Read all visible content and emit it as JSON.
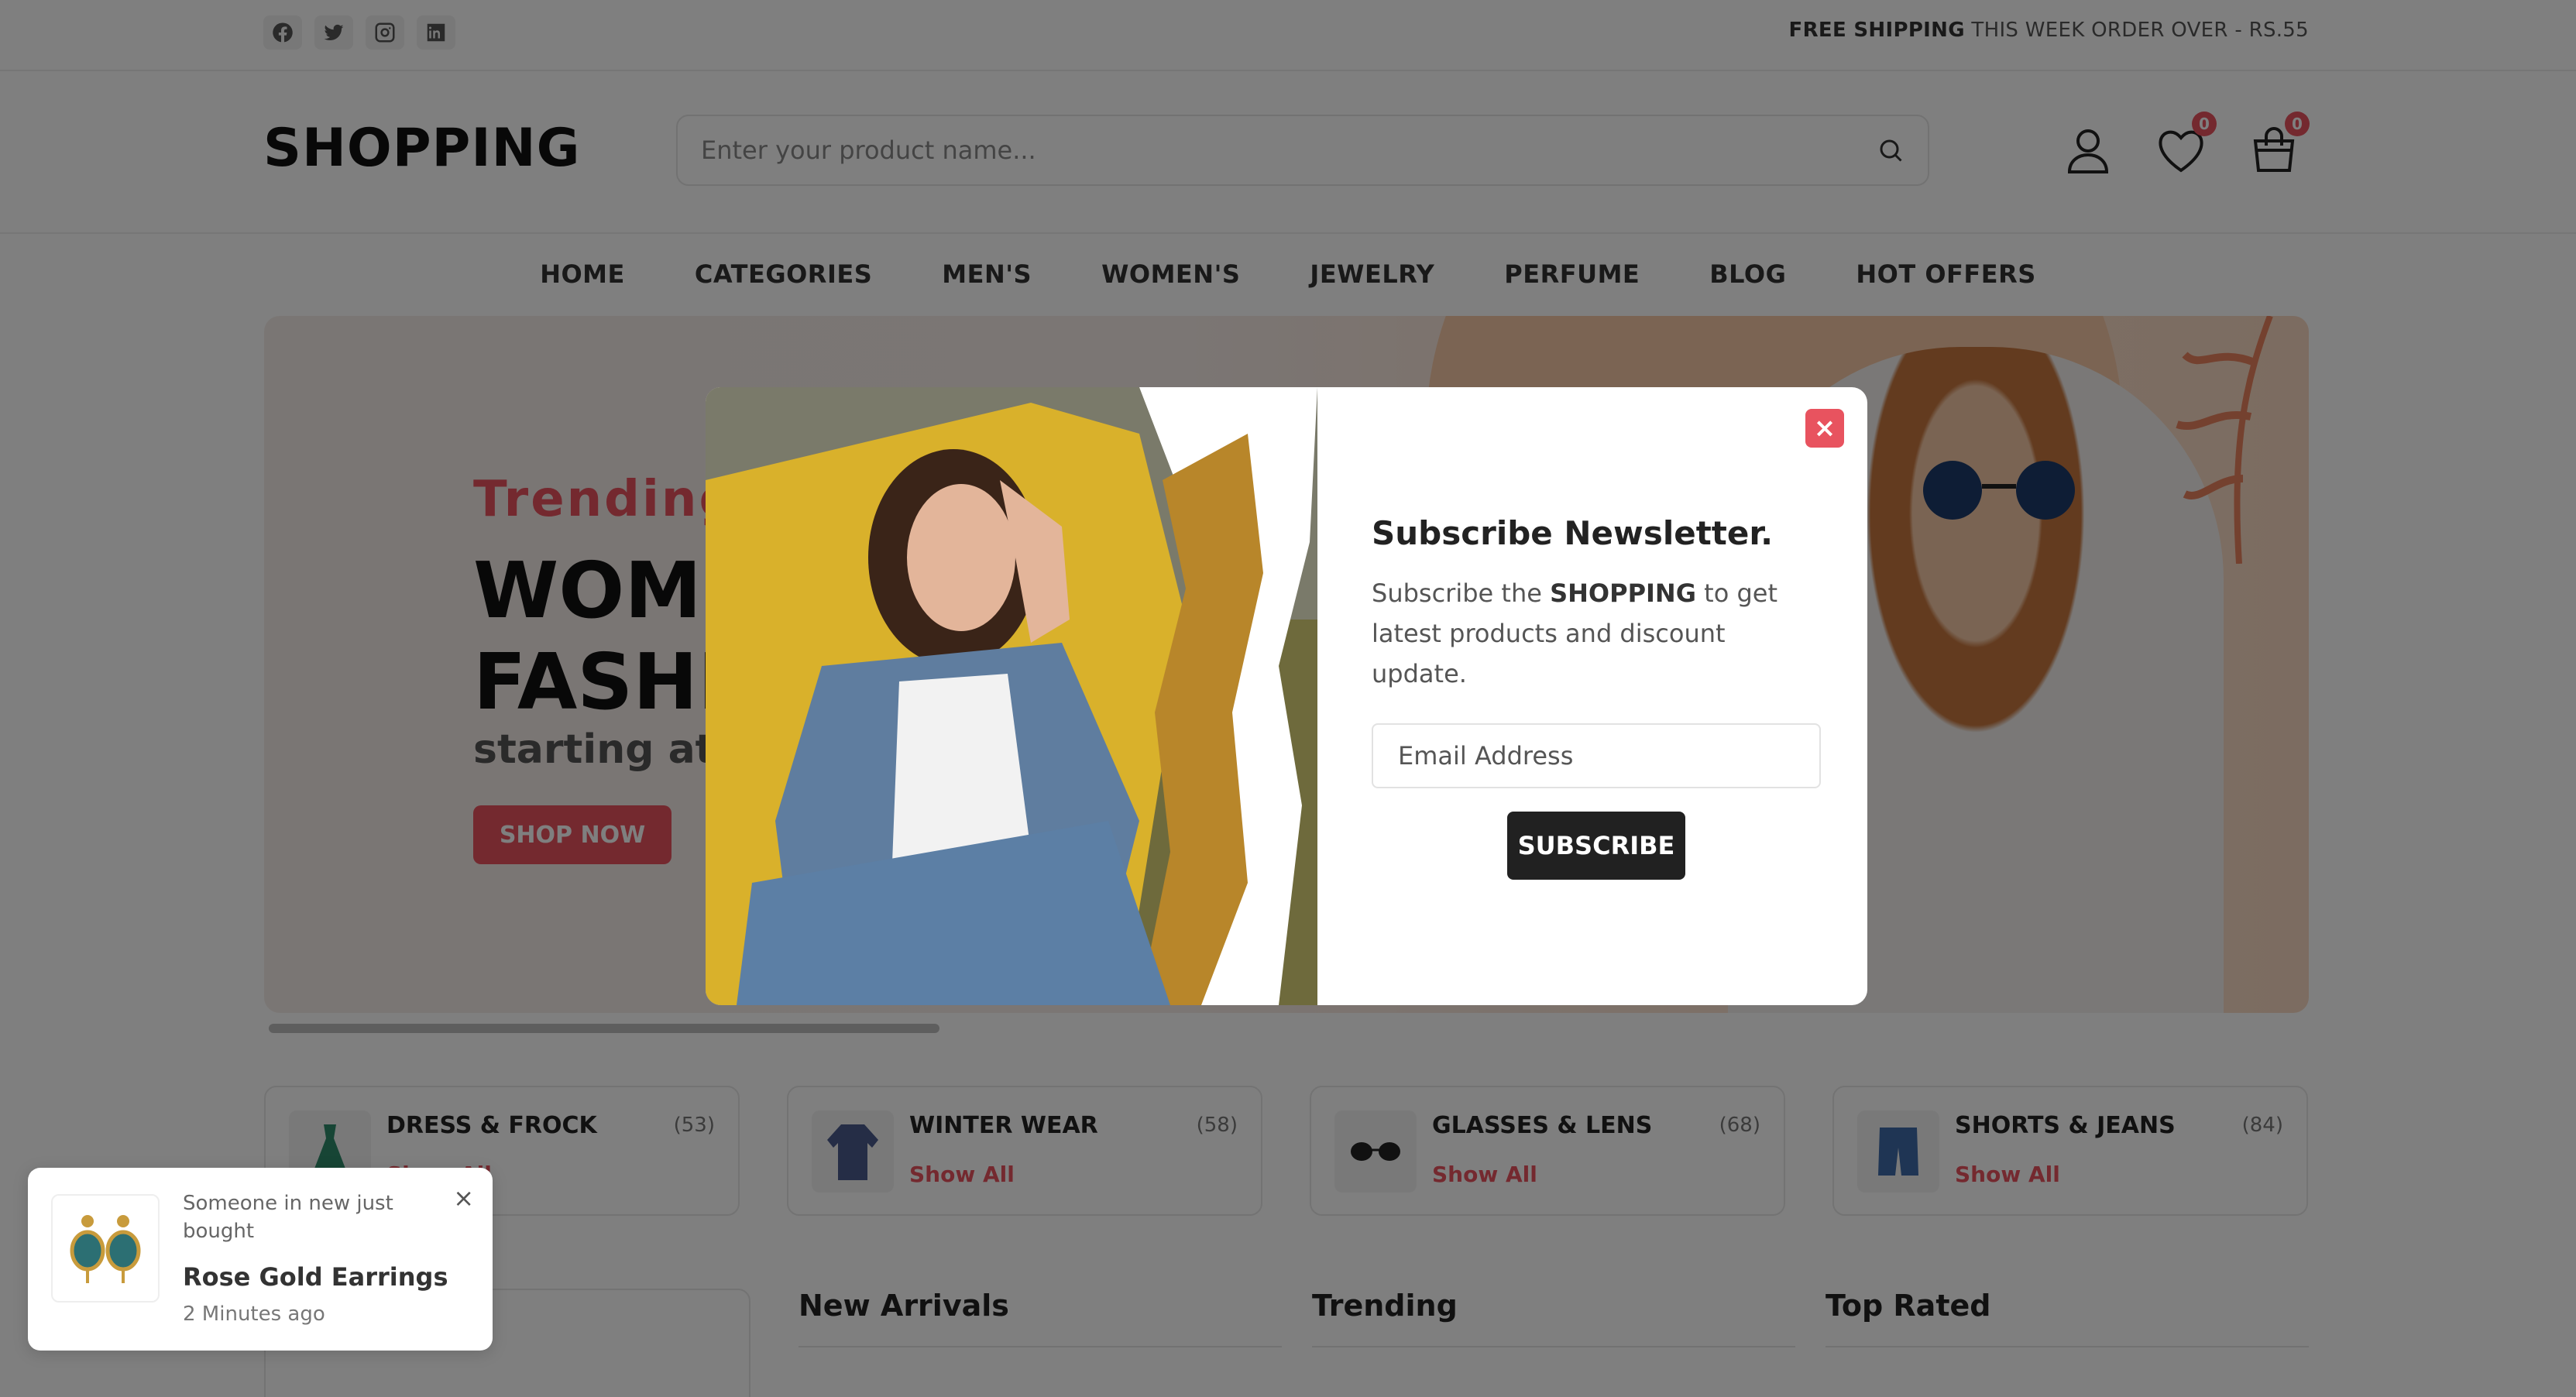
{
  "topbar": {
    "social": [
      "facebook-icon",
      "twitter-icon",
      "instagram-icon",
      "linkedin-icon"
    ],
    "shipping_bold": "FREE SHIPPING",
    "shipping_rest": " THIS WEEK ORDER OVER - RS.55"
  },
  "header": {
    "logo": "SHOPPING",
    "search_placeholder": "Enter your product name...",
    "wishlist_count": "0",
    "cart_count": "0"
  },
  "nav": [
    "HOME",
    "CATEGORIES",
    "MEN'S",
    "WOMEN'S",
    "JEWELRY",
    "PERFUME",
    "BLOG",
    "HOT OFFERS"
  ],
  "hero": {
    "eyebrow": "Trending",
    "title_line1": "WOME",
    "title_line2": "FASHI",
    "starting": "starting at $",
    "button": "SHOP NOW"
  },
  "categories": [
    {
      "name": "DRESS & FROCK",
      "count": "(53)",
      "link": "Show All",
      "icon": "dress-icon"
    },
    {
      "name": "WINTER WEAR",
      "count": "(58)",
      "link": "Show All",
      "icon": "jacket-icon"
    },
    {
      "name": "GLASSES & LENS",
      "count": "(68)",
      "link": "Show All",
      "icon": "glasses-icon"
    },
    {
      "name": "SHORTS & JEANS",
      "count": "(84)",
      "link": "Show All",
      "icon": "shorts-icon"
    }
  ],
  "sections": {
    "new_arrivals": "New Arrivals",
    "trending": "Trending",
    "top_rated": "Top Rated"
  },
  "modal": {
    "title": "Subscribe Newsletter.",
    "desc_before": "Subscribe the ",
    "desc_brand": "SHOPPING",
    "desc_after": " to get latest products and discount update.",
    "email_placeholder": "Email Address",
    "button": "SUBSCRIBE",
    "close": "×"
  },
  "toast": {
    "message": "Someone in new just bought",
    "product": "Rose Gold Earrings",
    "time": "2 Minutes ago",
    "close": "×"
  },
  "colors": {
    "accent": "#e8535f",
    "dark": "#212121"
  }
}
